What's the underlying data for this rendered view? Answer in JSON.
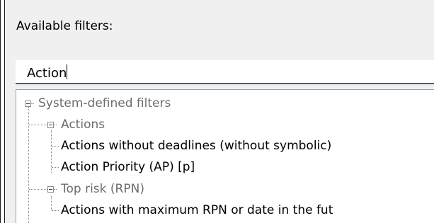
{
  "panel": {
    "label": "Available filters:"
  },
  "search": {
    "value": "Action"
  },
  "tree": {
    "root": {
      "label": "System-defined filters",
      "expanded": true,
      "children": [
        {
          "label": "Actions",
          "expanded": true,
          "children": [
            {
              "label": "Actions without deadlines (without symbolic)"
            },
            {
              "label": "Action Priority (AP) [p]"
            }
          ]
        },
        {
          "label": "Top risk (RPN)",
          "expanded": true,
          "children": [
            {
              "label": "Actions with maximum RPN or date in the fut"
            }
          ]
        }
      ]
    }
  },
  "icons": {
    "expander": "minus-box-icon"
  },
  "colors": {
    "focus_underline": "#0a63c8",
    "group_text": "#6d6d6d",
    "leaf_text": "#000000",
    "panel_bg": "#f0f0f0"
  }
}
